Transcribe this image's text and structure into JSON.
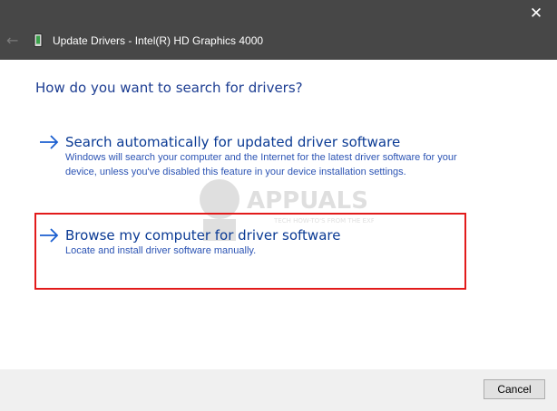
{
  "window": {
    "title": "Update Drivers - Intel(R) HD Graphics 4000",
    "close_glyph": "✕",
    "back_glyph": "←"
  },
  "main": {
    "heading": "How do you want to search for drivers?",
    "options": [
      {
        "title": "Search automatically for updated driver software",
        "description": "Windows will search your computer and the Internet for the latest driver software for your device, unless you've disabled this feature in your device installation settings."
      },
      {
        "title": "Browse my computer for driver software",
        "description": "Locate and install driver software manually."
      }
    ]
  },
  "watermark": {
    "brand": "APPUALS",
    "tagline": "TECH HOW-TO'S FROM THE EXPERTS"
  },
  "footer": {
    "cancel_label": "Cancel"
  },
  "colors": {
    "titlebar": "#474747",
    "heading": "#1c3d92",
    "link": "#0a3a94",
    "highlight": "#e21b1b"
  }
}
